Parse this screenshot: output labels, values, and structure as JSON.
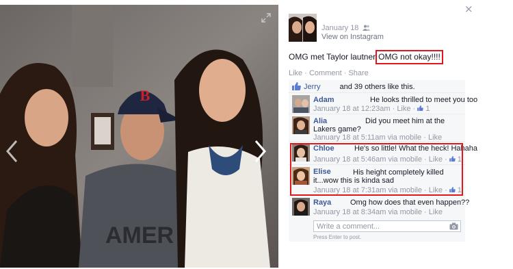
{
  "photo_viewer": {
    "expand_icon": "expand-icon",
    "prev_icon": "chevron-left-icon",
    "next_icon": "chevron-right-icon",
    "close_label": "×",
    "tshirt_text": "AMER"
  },
  "post": {
    "date": "January 18",
    "audience_icon": "friends-icon",
    "source": "View on Instagram",
    "caption_text": "OMG met Taylor lautner",
    "caption_highlight": "OMG not okay!!!!",
    "actions": {
      "like": "Like",
      "comment": "Comment",
      "share": "Share",
      "sep": " · "
    },
    "likes": {
      "name": "Jerry",
      "rest": "and 39 others like this."
    }
  },
  "comments": [
    {
      "name": "Adam",
      "text": "He looks thrilled to meet you too",
      "meta": "January 18 at 12:23am",
      "like": "Like",
      "count": "1"
    },
    {
      "name": "Alia",
      "text": "Did you meet him at the Lakers game?",
      "meta": "January 18 at 5:11am via mobile",
      "like": "Like",
      "count": ""
    },
    {
      "name": "Chloe",
      "text": "He's so little! What the heck! Hahaha",
      "meta": "January 18 at 5:46am via mobile",
      "like": "Like",
      "count": "1"
    },
    {
      "name": "Elise",
      "text": "His height completely killed it...wow this is kinda sad",
      "meta": "January 18 at 7:31am via mobile",
      "like": "Like",
      "count": "1"
    },
    {
      "name": "Raya",
      "text": "Omg how does that even happen??",
      "meta": "January 18 at 8:34am via mobile",
      "like": "Like",
      "count": ""
    }
  ],
  "composer": {
    "placeholder": "Write a comment...",
    "hint": "Press Enter to post."
  },
  "colors": {
    "link_blue": "#3b5998",
    "highlight_red": "#e0181b",
    "ufi_bg": "#f6f7f9"
  }
}
